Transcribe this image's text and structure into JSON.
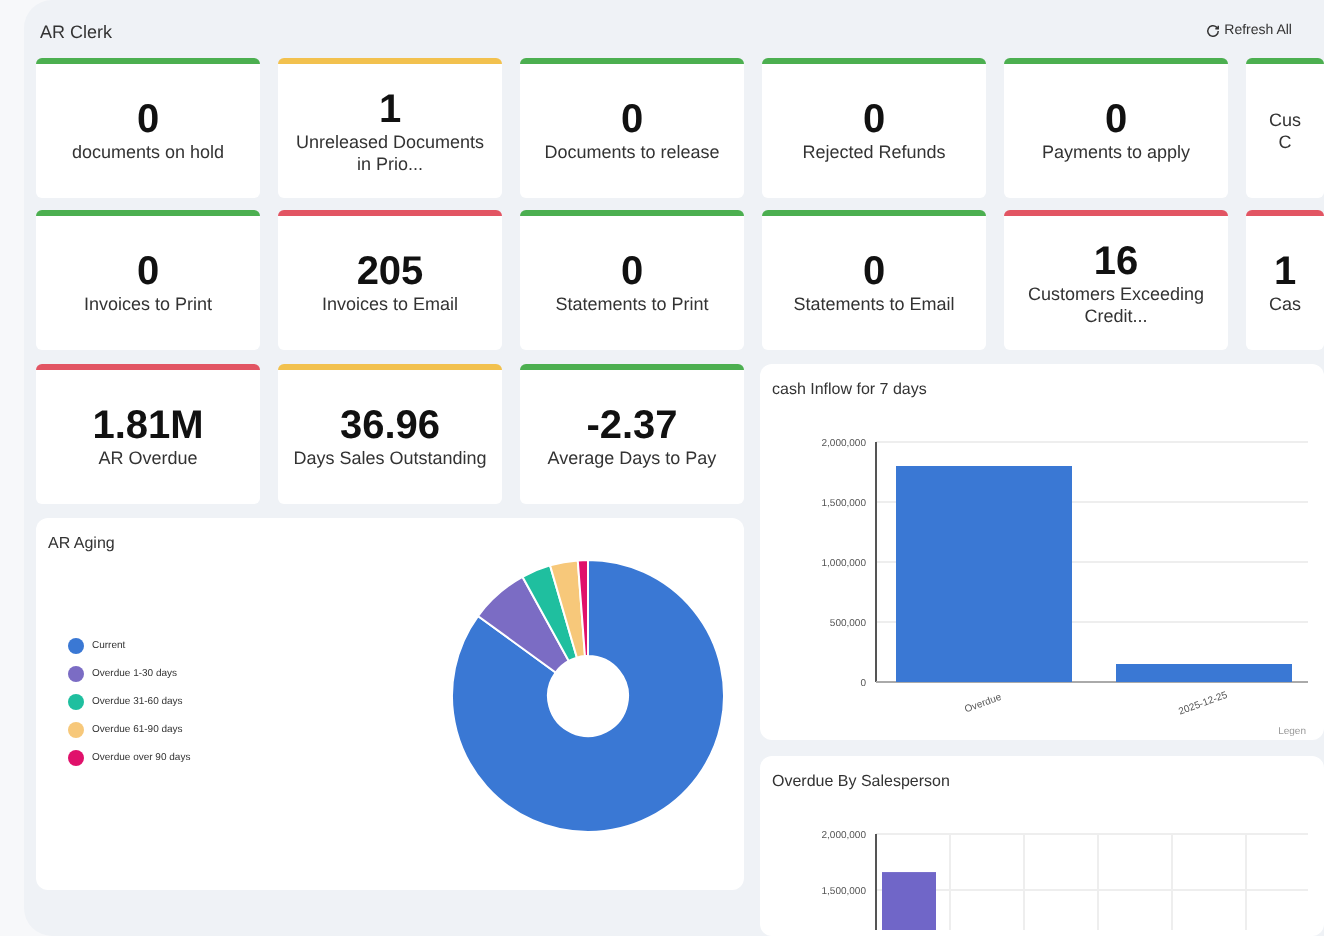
{
  "header": {
    "title": "AR Clerk",
    "refresh_button": "Refresh All"
  },
  "kpi_cards": [
    {
      "value": "0",
      "label": "documents on hold",
      "color": "#4caf50"
    },
    {
      "value": "1",
      "label": "Unreleased Documents in Prio...",
      "color": "#f2c14e"
    },
    {
      "value": "0",
      "label": "Documents to release",
      "color": "#4caf50"
    },
    {
      "value": "0",
      "label": "Rejected Refunds",
      "color": "#4caf50"
    },
    {
      "value": "0",
      "label": "Payments to apply",
      "color": "#4caf50"
    },
    {
      "label": "Cus\nC",
      "color": "#4caf50"
    },
    {
      "value": "0",
      "label": "Invoices to Print",
      "color": "#4caf50"
    },
    {
      "value": "205",
      "label": "Invoices to Email",
      "color": "#e25563"
    },
    {
      "value": "0",
      "label": "Statements to Print",
      "color": "#4caf50"
    },
    {
      "value": "0",
      "label": "Statements to Email",
      "color": "#4caf50"
    },
    {
      "value": "16",
      "label": "Customers Exceeding Credit...",
      "color": "#e25563"
    },
    {
      "value": "1",
      "label": "Cas",
      "color": "#e25563"
    }
  ],
  "summary_cards": [
    {
      "value": "1.81M",
      "label": "AR Overdue",
      "color": "#e25563"
    },
    {
      "value": "36.96",
      "label": "Days Sales Outstanding",
      "color": "#f2c14e"
    },
    {
      "value": "-2.37",
      "label": "Average Days to Pay",
      "color": "#4caf50"
    }
  ],
  "ar_aging": {
    "title": "AR Aging",
    "chart_data": {
      "type": "donut",
      "categories": [
        "Current",
        "Overdue 1-30 days",
        "Overdue 31-60 days",
        "Overdue 61-90 days",
        "Overdue over 90 days"
      ],
      "colors": [
        "#3a78d4",
        "#7b6cc4",
        "#1fbf9f",
        "#f7c87a",
        "#e0116b"
      ],
      "values": [
        85,
        7,
        3.5,
        3.3,
        1.2
      ]
    }
  },
  "cash_inflow": {
    "title": "cash Inflow for 7 days",
    "legend": "Legen",
    "chart_data": {
      "type": "bar",
      "categories": [
        "Overdue",
        "2025-12-25"
      ],
      "color": "#3a78d4",
      "values": [
        1800000,
        150000
      ],
      "ylim": [
        0,
        2000000
      ],
      "grid": true,
      "yticks": [
        {
          "value": 0,
          "label": "0"
        },
        {
          "value": 500000,
          "label": "500,000"
        },
        {
          "value": 1000000,
          "label": "1,000,000"
        },
        {
          "value": 1500000,
          "label": "1,500,000"
        },
        {
          "value": 2000000,
          "label": "2,000,000"
        }
      ]
    }
  },
  "overdue_by_salesperson": {
    "title": "Overdue By Salesperson",
    "chart_data": {
      "type": "bar",
      "color": "#7066c8",
      "values": [
        1660000
      ],
      "ylim": [
        1142857,
        2000000
      ],
      "grid": true,
      "yticks": [
        {
          "value": 1500000,
          "label": "1,500,000"
        },
        {
          "value": 2000000,
          "label": "2,000,000"
        }
      ]
    }
  }
}
